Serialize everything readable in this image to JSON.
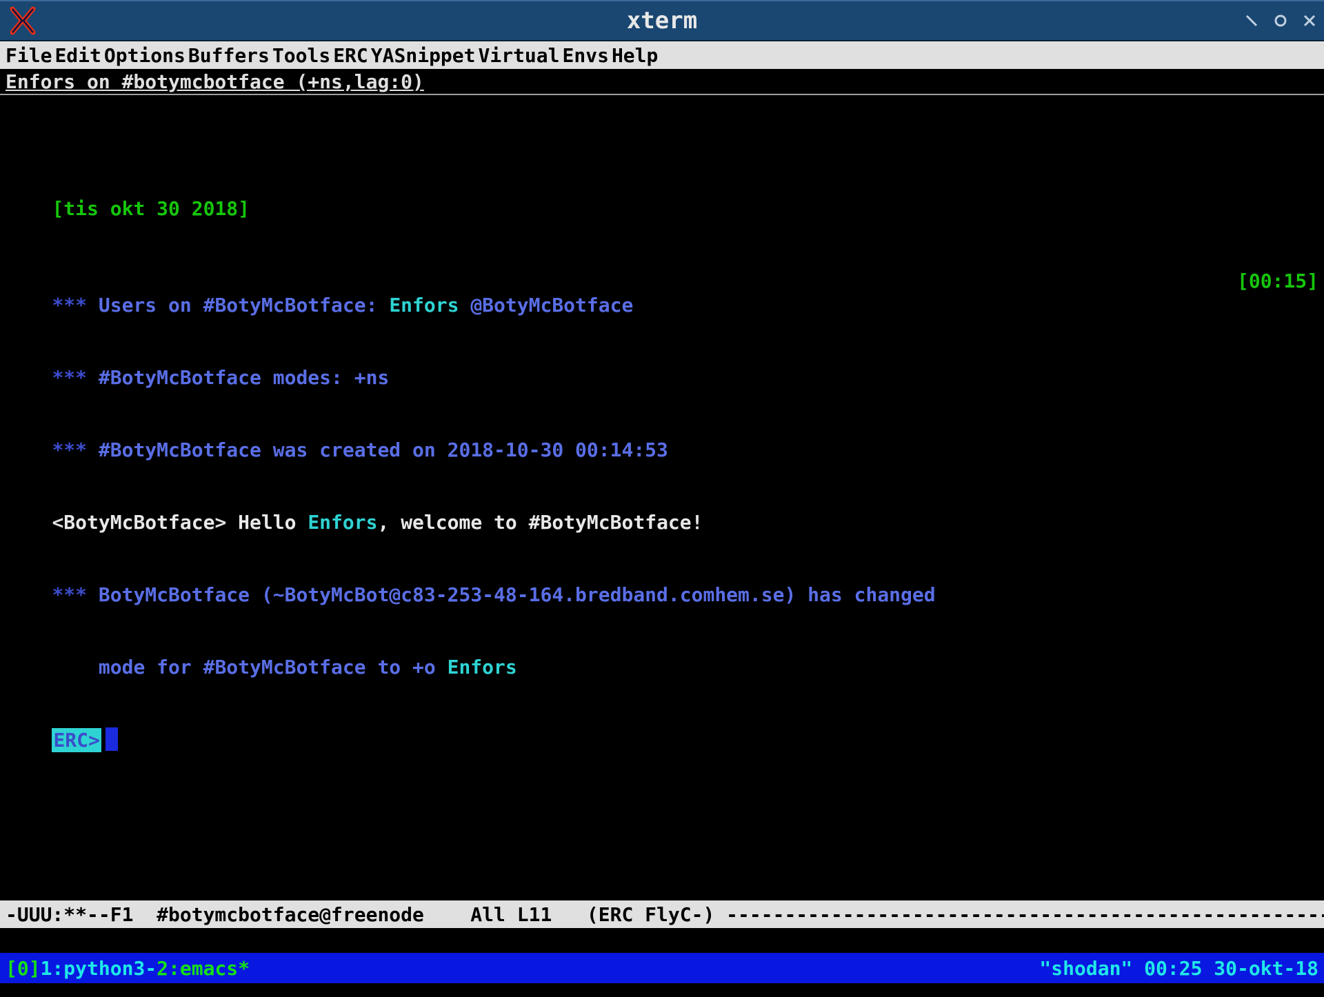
{
  "window": {
    "title": "xterm"
  },
  "menubar": {
    "items": [
      "File",
      "Edit",
      "Options",
      "Buffers",
      "Tools",
      "ERC",
      "YASnippet",
      "Virtual",
      "Envs",
      "Help"
    ]
  },
  "headerline": {
    "text": "Enfors on #botymcbotface (+ns,lag:0)"
  },
  "irc": {
    "date_header": "[tis okt 30 2018]",
    "timestamp": "[00:15]",
    "line1_prefix": "*** ",
    "line1_a": "Users on #BotyMcBotface: ",
    "line1_b": "Enfors",
    "line1_c": " @BotyMcBotface",
    "line2_prefix": "*** ",
    "line2": "#BotyMcBotface modes: +ns",
    "line3_prefix": "*** ",
    "line3": "#BotyMcBotface was created on 2018-10-30 00:14:53",
    "greet_nick_open": "<",
    "greet_nick": "BotyMcBotface",
    "greet_nick_close": "> ",
    "greet_a": "Hello ",
    "greet_b": "Enfors",
    "greet_c": ", welcome to #BotyMcBotface!",
    "mode_prefix": "*** ",
    "mode_a": "BotyMcBotface (~BotyMcBot@c83-253-48-164.bredband.comhem.se) has changed",
    "mode_b_indent": "    mode for #BotyMcBotface to +o ",
    "mode_b_target": "Enfors",
    "prompt": "ERC>"
  },
  "modeline": {
    "left": "-UUU:**--F1  #botymcbotface@freenode    All L11   (ERC FlyC-) --------------------------------------------------------"
  },
  "tmux": {
    "session": "[0]",
    "win1": "1:python3-",
    "win2": " 2:emacs*",
    "right": "\"shodan\" 00:25 30-okt-18"
  }
}
